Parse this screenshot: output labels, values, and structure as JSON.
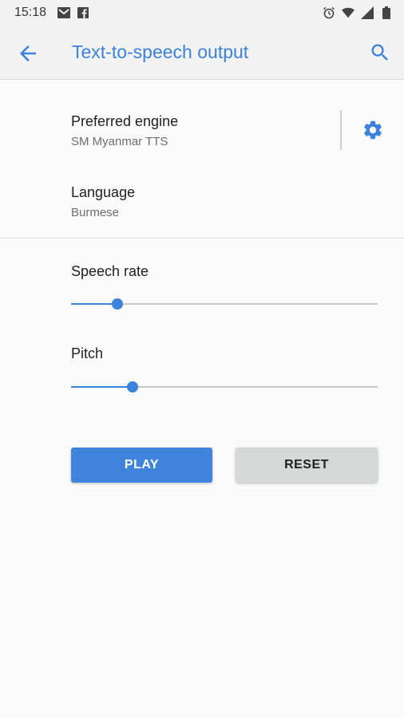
{
  "status_bar": {
    "time": "15:18",
    "left_icons": [
      "gmail-icon",
      "facebook-icon"
    ],
    "right_icons": [
      "alarm-icon",
      "wifi-icon",
      "signal-icon",
      "battery-icon"
    ]
  },
  "app_bar": {
    "title": "Text-to-speech output",
    "back_icon": "arrow-back-icon",
    "search_icon": "search-icon"
  },
  "preferences": {
    "engine": {
      "title": "Preferred engine",
      "summary": "SM Myanmar TTS",
      "settings_icon": "gear-icon"
    },
    "language": {
      "title": "Language",
      "summary": "Burmese"
    }
  },
  "sliders": {
    "speech_rate": {
      "label": "Speech rate",
      "value": 0.15
    },
    "pitch": {
      "label": "Pitch",
      "value": 0.2
    }
  },
  "buttons": {
    "play_label": "PLAY",
    "reset_label": "RESET"
  },
  "colors": {
    "accent": "#3b82dc",
    "background": "#fafafa",
    "app_bar": "#f2f2f2"
  }
}
